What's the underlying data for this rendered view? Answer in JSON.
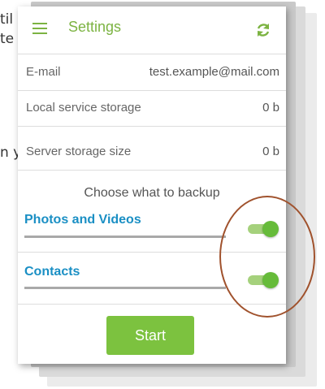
{
  "background_text": [
    "til",
    "te",
    "n y"
  ],
  "header": {
    "menu_icon": "hamburger-menu-icon",
    "title": "Settings",
    "refresh_icon": "refresh-icon"
  },
  "info_rows": [
    {
      "label": "E-mail",
      "value": "test.example@mail.com"
    },
    {
      "label": "Local service storage",
      "value": "0 b"
    },
    {
      "label": "Server storage size",
      "value": "0 b"
    }
  ],
  "backup": {
    "section_title": "Choose what to backup",
    "options": [
      {
        "label": "Photos and Videos",
        "enabled": true
      },
      {
        "label": "Contacts",
        "enabled": true
      }
    ]
  },
  "start_button": {
    "label": "Start"
  },
  "colors": {
    "accent": "#7cb342",
    "toggle_label": "#1a8fc4",
    "button": "#7cc23f",
    "annotation_circle": "#a0522d"
  }
}
